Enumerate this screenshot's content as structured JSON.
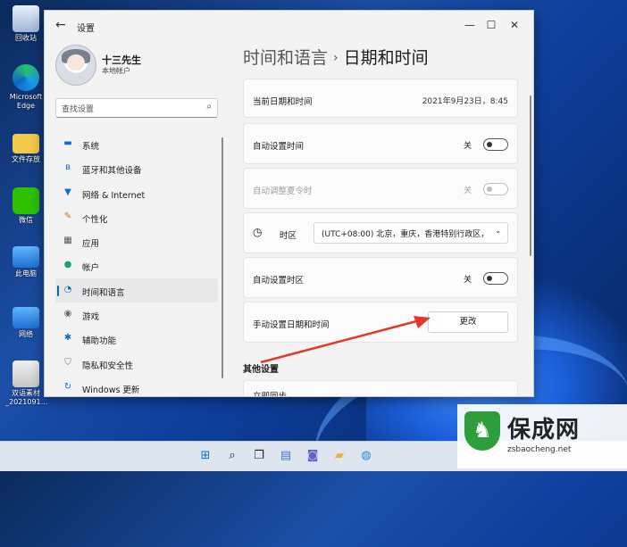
{
  "desktop": {
    "icons": [
      {
        "label": "回收站"
      },
      {
        "label": "Microsoft Edge"
      },
      {
        "label": "文件存放"
      },
      {
        "label": "微信"
      },
      {
        "label": "此电脑"
      },
      {
        "label": "网络"
      },
      {
        "label": "双语素材 _2021091..."
      }
    ]
  },
  "window": {
    "title": "设置",
    "buttons": {
      "minimize": "—",
      "maximize": "☐",
      "close": "✕"
    }
  },
  "profile": {
    "name": "十三先生",
    "account": "本地帐户"
  },
  "search": {
    "placeholder": "查找设置"
  },
  "nav": {
    "items": [
      {
        "label": "系统"
      },
      {
        "label": "蓝牙和其他设备"
      },
      {
        "label": "网络 & Internet"
      },
      {
        "label": "个性化"
      },
      {
        "label": "应用"
      },
      {
        "label": "帐户"
      },
      {
        "label": "时间和语言"
      },
      {
        "label": "游戏"
      },
      {
        "label": "辅助功能"
      },
      {
        "label": "隐私和安全性"
      },
      {
        "label": "Windows 更新"
      }
    ]
  },
  "breadcrumb": {
    "parent": "时间和语言",
    "current": "日期和时间"
  },
  "datetime": {
    "current_label": "当前日期和时间",
    "current_value": "2021年9月23日，8:45",
    "auto_time_label": "自动设置时间",
    "auto_time_state": "关",
    "auto_dst_label": "自动调整夏令时",
    "auto_dst_state": "关",
    "timezone_label": "时区",
    "timezone_value": "(UTC+08:00) 北京，重庆，香港特别行政区，",
    "auto_tz_label": "自动设置时区",
    "auto_tz_state": "关",
    "manual_label": "手动设置日期和时间",
    "change_button": "更改"
  },
  "other": {
    "heading": "其他设置",
    "sync_label": "立即同步"
  },
  "annotation": {
    "arrow_color": "#e2382b"
  },
  "watermark": {
    "title": "保成网",
    "url": "zsbaocheng.net"
  },
  "colors": {
    "accent": "#0067c0"
  }
}
